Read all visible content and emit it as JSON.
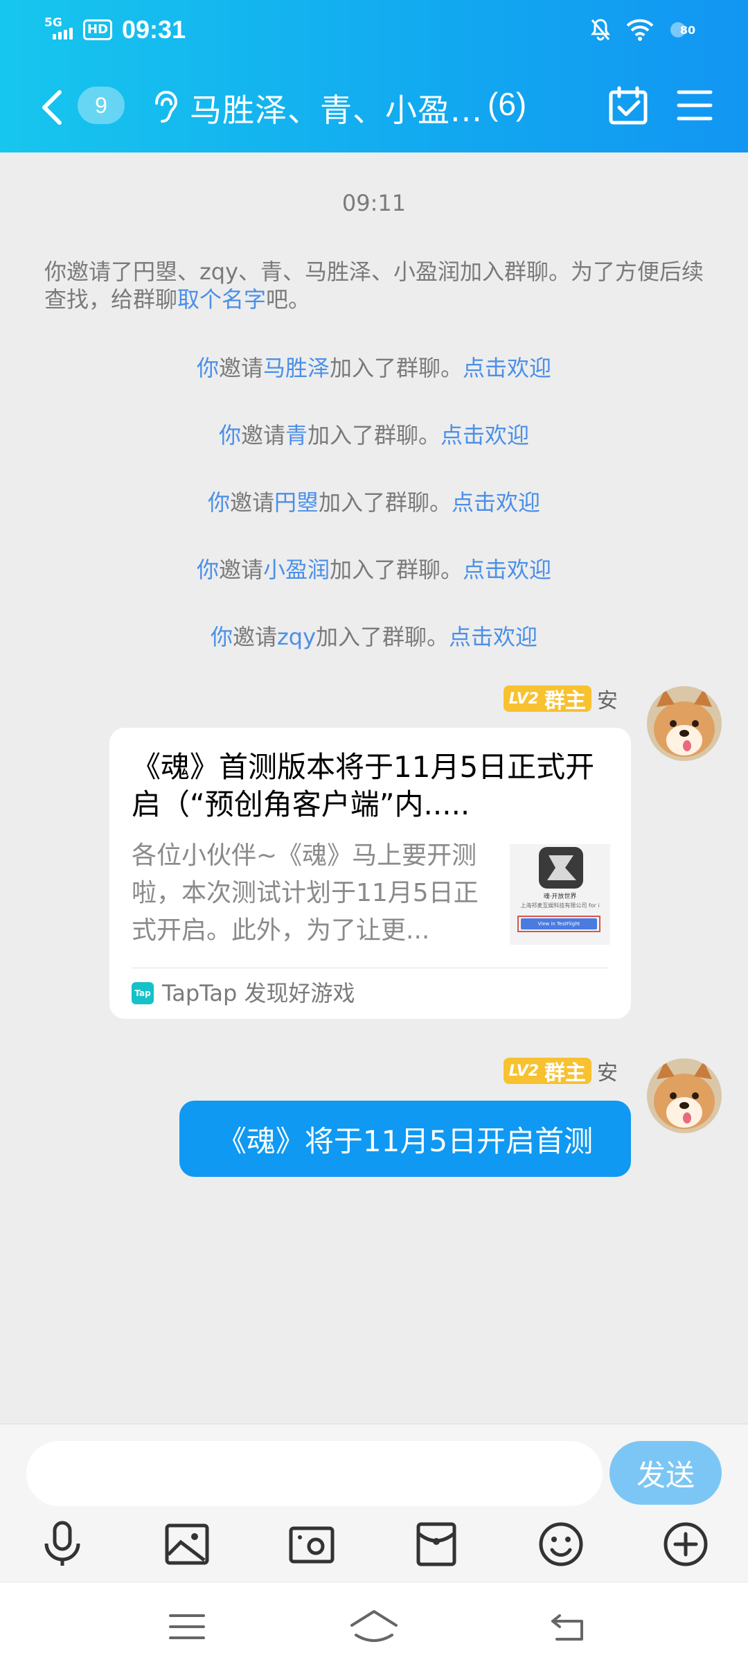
{
  "status_bar": {
    "network": "5G",
    "hd": "HD",
    "time": "09:31",
    "battery": "80"
  },
  "header": {
    "unread_badge": "9",
    "title": "马胜泽、青、小盈...",
    "member_count": "(6)"
  },
  "chat": {
    "timestamp": "09:11",
    "intro": {
      "text_before": "你邀请了円曌、zqy、青、马胜泽、小盈润加入群聊。为了方便后续查找，给群聊",
      "link": "取个名字",
      "text_after": "吧。"
    },
    "invites": [
      {
        "you": "你",
        "verb": "邀请",
        "name": "马胜泽",
        "suffix": "加入了群聊。",
        "action": "点击欢迎"
      },
      {
        "you": "你",
        "verb": "邀请",
        "name": "青",
        "suffix": "加入了群聊。",
        "action": "点击欢迎"
      },
      {
        "you": "你",
        "verb": "邀请",
        "name": "円曌",
        "suffix": "加入了群聊。",
        "action": "点击欢迎"
      },
      {
        "you": "你",
        "verb": "邀请",
        "name": "小盈润",
        "suffix": "加入了群聊。",
        "action": "点击欢迎"
      },
      {
        "you": "你",
        "verb": "邀请",
        "name": "zqy",
        "suffix": "加入了群聊。",
        "action": "点击欢迎"
      }
    ],
    "messages": [
      {
        "level": "LV2",
        "role": "群主",
        "sender": "安",
        "card_title": "《魂》首测版本将于11月5日正式开启（“预创角客户端”内.....",
        "card_desc": "各位小伙伴~《魂》马上要开测啦，本次测试计划于11月5日正式开启。此外，为了让更...",
        "thumb_title": "魂·开放世界",
        "thumb_sub": "上海祁麦互娱科技有限公司 for i",
        "thumb_btn": "View in TestFlight",
        "card_source": "TapTap 发现好游戏",
        "source_icon": "Tap"
      },
      {
        "level": "LV2",
        "role": "群主",
        "sender": "安",
        "text": "《魂》将于11月5日开启首测"
      }
    ]
  },
  "input": {
    "placeholder": "",
    "send_label": "发送"
  },
  "colors": {
    "header_start": "#17c6ee",
    "header_end": "#1296f2",
    "link": "#4a8fe8",
    "bubble": "#0f99f2",
    "send_disabled": "#7cc6f5",
    "level_badge": "#f7c130"
  }
}
